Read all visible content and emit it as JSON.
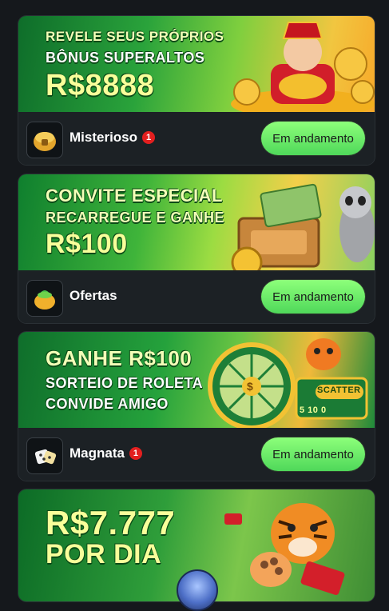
{
  "cards": [
    {
      "banner_lines": [
        "REVELE SEUS PRÓPRIOS",
        "BÔNUS SUPERALTOS",
        "R$8888"
      ],
      "name": "Misterioso",
      "badge": "1",
      "icon": "treasure-chest-icon",
      "button_label": "Em andamento"
    },
    {
      "banner_lines": [
        "CONVITE ESPECIAL",
        "RECARREGUE E GANHE",
        "R$100"
      ],
      "name": "Ofertas",
      "badge": "",
      "icon": "gift-bag-icon",
      "button_label": "Em andamento"
    },
    {
      "banner_lines": [
        "GANHE R$100",
        "SORTEIO DE ROLETA",
        "CONVIDE AMIGO"
      ],
      "name": "Magnata",
      "badge": "1",
      "icon": "dice-icon",
      "button_label": "Em andamento"
    },
    {
      "banner_lines": [
        "R$7.777",
        "POR DIA"
      ]
    }
  ],
  "banner_extras": {
    "wheel_label": "$",
    "scatter_label": "SCATTER",
    "slot_text": "5 10 0"
  },
  "colors": {
    "accent_green": "#4fd85a",
    "badge_red": "#e31f1f",
    "background": "#15181c"
  }
}
